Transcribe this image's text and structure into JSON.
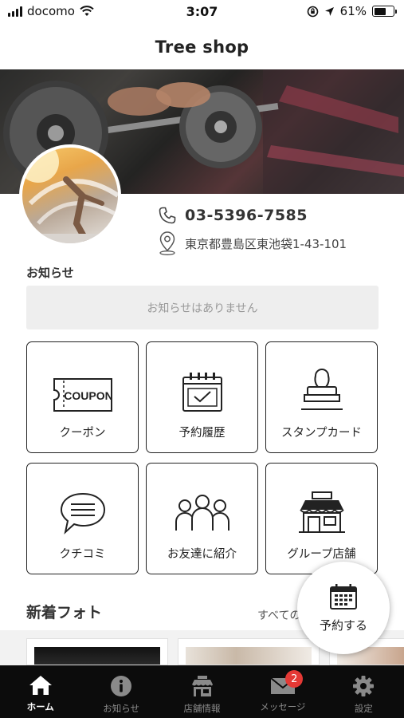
{
  "status_bar": {
    "carrier": "docomo",
    "time": "3:07",
    "battery": "61%",
    "battery_level": 0.61
  },
  "header": {
    "title": "Tree shop"
  },
  "shop": {
    "phone": "03-5396-7585",
    "address": "東京都豊島区東池袋1-43-101"
  },
  "news": {
    "heading": "お知らせ",
    "empty_message": "お知らせはありません"
  },
  "menu": [
    {
      "label": "クーポン",
      "icon": "coupon-icon",
      "coupon_text": "COUPON"
    },
    {
      "label": "予約履歴",
      "icon": "calendar-check-icon"
    },
    {
      "label": "スタンプカード",
      "icon": "stamp-icon"
    },
    {
      "label": "クチコミ",
      "icon": "speech-bubble-icon"
    },
    {
      "label": "お友達に紹介",
      "icon": "people-group-icon"
    },
    {
      "label": "グループ店舗",
      "icon": "storefront-icon"
    }
  ],
  "photos": {
    "heading": "新着フォト",
    "see_all": "すべての"
  },
  "reserve_button": {
    "label": "予約する",
    "icon": "calendar-icon"
  },
  "tab_bar": {
    "tabs": [
      {
        "label": "ホーム",
        "icon": "home-icon",
        "active": true
      },
      {
        "label": "お知らせ",
        "icon": "info-icon",
        "active": false
      },
      {
        "label": "店舗情報",
        "icon": "shop-icon",
        "active": false
      },
      {
        "label": "メッセージ",
        "icon": "envelope-icon",
        "active": false,
        "badge": "2"
      },
      {
        "label": "設定",
        "icon": "gear-icon",
        "active": false
      }
    ]
  },
  "colors": {
    "tab_bar_bg": "#0c0c0c",
    "badge": "#e53935",
    "news_box_bg": "#eeeeee"
  }
}
